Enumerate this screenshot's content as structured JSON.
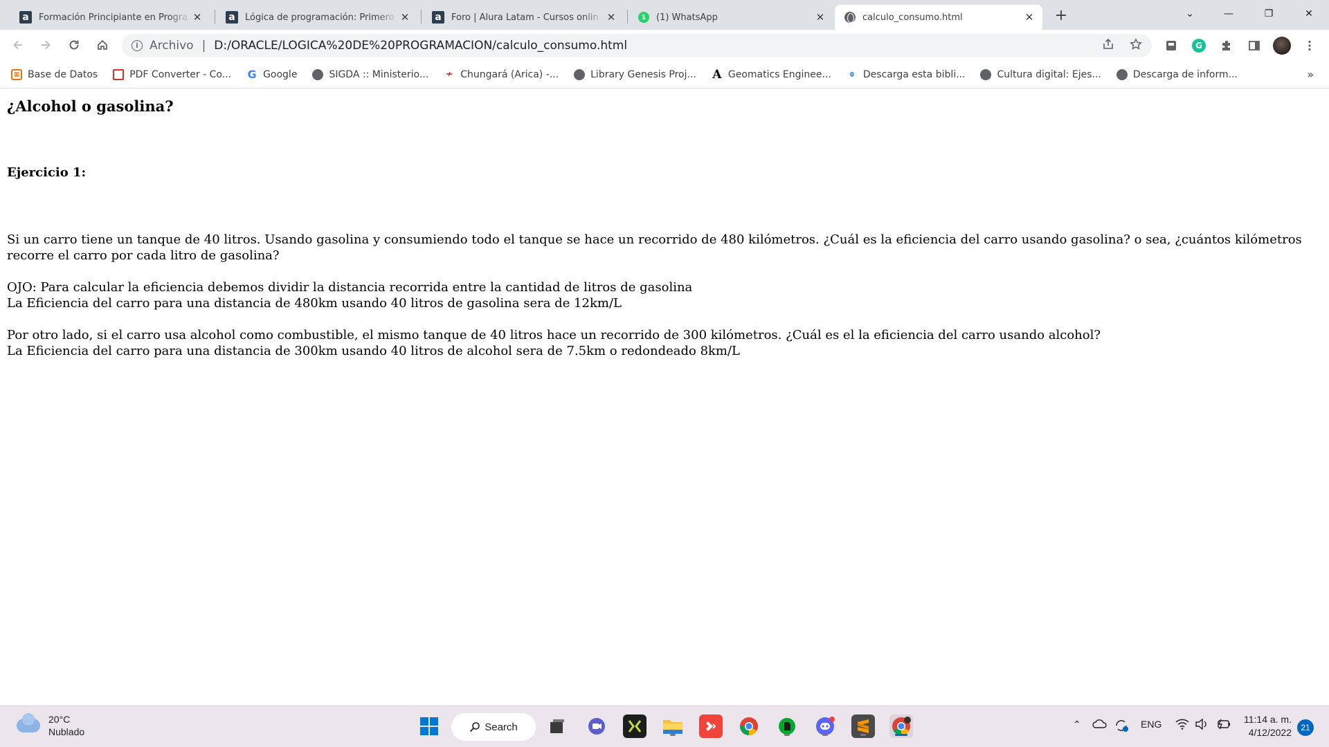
{
  "browser": {
    "tabs": [
      {
        "title": "Formación Principiante en Progra",
        "favicon": "alura-icon"
      },
      {
        "title": "Lógica de programación: Primero",
        "favicon": "alura-icon"
      },
      {
        "title": "Foro | Alura Latam - Cursos onlin",
        "favicon": "alura-icon"
      },
      {
        "title": "(1) WhatsApp",
        "favicon": "whatsapp-icon"
      },
      {
        "title": "calculo_consumo.html",
        "favicon": "globe-icon"
      }
    ],
    "active_tab_index": 4,
    "new_tab_symbol": "+",
    "window_controls": {
      "dropdown": "⌄",
      "minimize": "—",
      "restore": "❐",
      "close": "✕"
    },
    "omnibox": {
      "security_label": "Archivo",
      "separator": "|",
      "url": "D:/ORACLE/LOGICA%20DE%20PROGRAMACION/calculo_consumo.html"
    },
    "extensions": [
      "extension-puzzle-icon",
      "grammarly-icon",
      "extensions-icon",
      "side-panel-icon",
      "profile-avatar",
      "menu-icon"
    ],
    "bookmarks": [
      {
        "label": "Base de Datos",
        "icon": "database-icon"
      },
      {
        "label": "PDF Converter - Co...",
        "icon": "pdf-icon"
      },
      {
        "label": "Google",
        "icon": "google-icon"
      },
      {
        "label": "SIGDA :: Ministerio...",
        "icon": "globe-icon"
      },
      {
        "label": "Chungará (Arica) -...",
        "icon": "chungara-icon"
      },
      {
        "label": "Library Genesis Proj...",
        "icon": "globe-icon"
      },
      {
        "label": "Geomatics Enginee...",
        "icon": "letter-a-icon"
      },
      {
        "label": "Descarga esta bibli...",
        "icon": "clip-icon"
      },
      {
        "label": "Cultura digital: Ejes...",
        "icon": "globe-icon"
      },
      {
        "label": "Descarga de inform...",
        "icon": "globe-icon"
      }
    ],
    "bookmarks_more": "»"
  },
  "page": {
    "title": "¿Alcohol o gasolina?",
    "exercise_heading": "Ejercicio 1:",
    "paragraph1": "Si un carro tiene un tanque de 40 litros. Usando gasolina y consumiendo todo el tanque se hace un recorrido de 480 kilómetros. ¿Cuál es la eficiencia del carro usando gasolina? o sea, ¿cuántos kilómetros recorre el carro por cada litro de gasolina?",
    "note_line1": "OJO: Para calcular la eficiencia debemos dividir la distancia recorrida entre la cantidad de litros de gasolina",
    "note_line2": "La Eficiencia del carro para una distancia de 480km usando 40 litros de gasolina sera de 12km/L",
    "paragraph3_line1": "Por otro lado, si el carro usa alcohol como combustible, el mismo tanque de 40 litros hace un recorrido de 300 kilómetros. ¿Cuál es el la eficiencia del carro usando alcohol?",
    "paragraph3_line2": "La Eficiencia del carro para una distancia de 300km usando 40 litros de alcohol sera de 7.5km o redondeado 8km/L"
  },
  "taskbar": {
    "weather": {
      "temperature": "20°C",
      "condition": "Nublado"
    },
    "search_label": "Search",
    "apps": [
      "windows-start-icon",
      "task-view-icon",
      "teams-chat-icon",
      "xampp-icon",
      "file-explorer-icon",
      "anydesk-icon",
      "chrome-icon",
      "evernote-icon",
      "discord-icon",
      "sublime-text-icon",
      "chrome-profile-icon"
    ],
    "tray": {
      "language": "ENG"
    },
    "clock": {
      "time": "11:14 a. m.",
      "date": "4/12/2022"
    },
    "notification_count": "21"
  },
  "colors": {
    "tabstrip_bg": "#dee1e6",
    "taskbar_bg": "#ece6ec",
    "accent": "#0067c0",
    "whatsapp": "#25d366",
    "grammarly": "#15c39a"
  }
}
